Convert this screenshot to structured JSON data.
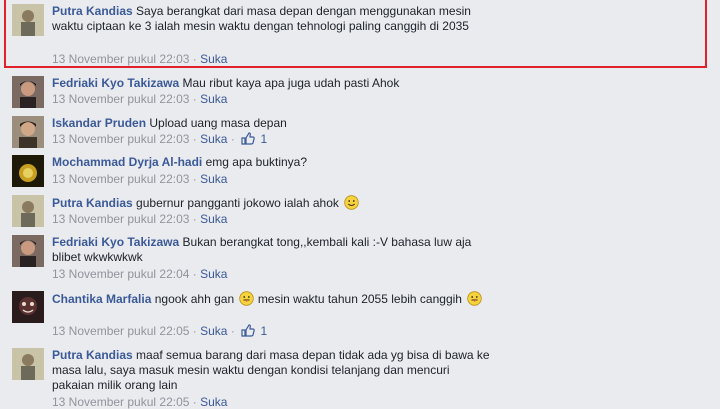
{
  "separator": "·",
  "comments": [
    {
      "author": "Putra Kandias",
      "text": "Saya berangkat dari masa depan dengan menggunakan mesin waktu ciptaan ke 3 ialah mesin waktu dengan tehnologi paling canggih di 2035",
      "timestamp": "13 November pukul 22:03",
      "like_label": "Suka",
      "likes": null,
      "emoticon": null,
      "avatar_color": "#b8b39a",
      "highlighted": true
    },
    {
      "author": "Fedriaki Kyo Takizawa",
      "text": "Mau ribut kaya apa juga udah pasti Ahok",
      "timestamp": "13 November pukul 22:03",
      "like_label": "Suka",
      "likes": null,
      "emoticon": null,
      "avatar_color": "#5a4a44",
      "highlighted": false
    },
    {
      "author": "Iskandar Pruden",
      "text": "Upload uang masa depan",
      "timestamp": "13 November pukul 22:03",
      "like_label": "Suka",
      "likes": "1",
      "emoticon": null,
      "avatar_color": "#6b5a4a",
      "highlighted": false
    },
    {
      "author": "Mochammad Dyrja Al-hadi",
      "text": "emg apa buktinya?",
      "timestamp": "13 November pukul 22:03",
      "like_label": "Suka",
      "likes": null,
      "emoticon": null,
      "avatar_color": "#3a3010",
      "highlighted": false
    },
    {
      "author": "Putra Kandias",
      "text": "gubernur pangganti jokowo ialah ahok",
      "timestamp": "13 November pukul 22:03",
      "like_label": "Suka",
      "likes": null,
      "emoticon": "smile-emoticon",
      "avatar_color": "#b8b39a",
      "highlighted": false
    },
    {
      "author": "Fedriaki Kyo Takizawa",
      "text": "Bukan berangkat tong,,kembali kali :-V bahasa luw aja blibet wkwkwkwk",
      "timestamp": "13 November pukul 22:04",
      "like_label": "Suka",
      "likes": null,
      "emoticon": null,
      "avatar_color": "#5a4a44",
      "highlighted": false
    },
    {
      "author": "Chantika Marfalia",
      "text": "ngook ahh gan",
      "text_after": "mesin waktu tahun 2055 lebih canggih",
      "timestamp": "13 November pukul 22:05",
      "like_label": "Suka",
      "likes": "1",
      "emoticon": "tongue-emoticon",
      "avatar_color": "#2a1c1c",
      "highlighted": false
    },
    {
      "author": "Putra Kandias",
      "text": "maaf semua barang dari masa depan tidak ada yg bisa di bawa ke masa lalu, saya masuk mesin waktu dengan kondisi telanjang dan mencuri pakaian milik orang lain",
      "timestamp": "13 November pukul 22:05",
      "like_label": "Suka",
      "likes": null,
      "emoticon": null,
      "avatar_color": "#b8b39a",
      "highlighted": false
    }
  ]
}
